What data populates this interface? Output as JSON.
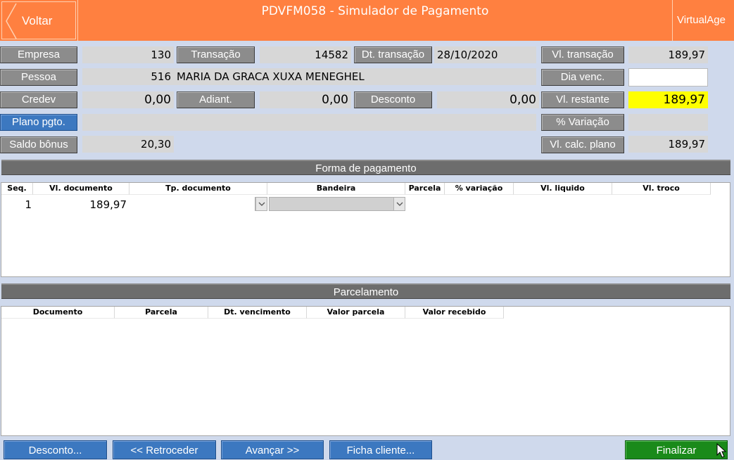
{
  "header": {
    "back_label": "Voltar",
    "title": "PDVFM058 - Simulador de Pagamento",
    "brand": "VirtualAge",
    "color": "#ff8040"
  },
  "form": {
    "empresa_label": "Empresa",
    "empresa_value": "130",
    "transacao_label": "Transação",
    "transacao_value": "14582",
    "dt_transacao_label": "Dt. transação",
    "dt_transacao_value": "28/10/2020",
    "vl_transacao_label": "Vl. transação",
    "vl_transacao_value": "189,97",
    "pessoa_label": "Pessoa",
    "pessoa_code": "516",
    "pessoa_name": "MARIA DA GRACA XUXA MENEGHEL",
    "dia_venc_label": "Dia venc.",
    "dia_venc_value": "",
    "credev_label": "Credev",
    "credev_value": "0,00",
    "adiant_label": "Adiant.",
    "adiant_value": "0,00",
    "desconto_label": "Desconto",
    "desconto_value": "0,00",
    "vl_restante_label": "Vl. restante",
    "vl_restante_value": "189,97",
    "plano_label": "Plano pgto.",
    "plano_value": "",
    "variacao_label": "% Variação",
    "variacao_value": "",
    "saldo_label": "Saldo bônus",
    "saldo_value": "20,30",
    "vl_calc_label": "Vl. calc. plano",
    "vl_calc_value": "189,97"
  },
  "forma_pagamento": {
    "title": "Forma de pagamento",
    "columns": [
      "Seq.",
      "Vl. documento",
      "Tp. documento",
      "Bandeira",
      "Parcela",
      "% variação",
      "Vl. liquido",
      "Vl. troco"
    ],
    "rows": [
      {
        "seq": "1",
        "vl_documento": "189,97",
        "tp_documento": "",
        "bandeira": "",
        "parcela": "",
        "variacao": "",
        "vl_liquido": "",
        "vl_troco": ""
      }
    ]
  },
  "parcelamento": {
    "title": "Parcelamento",
    "columns": [
      "Documento",
      "Parcela",
      "Dt. vencimento",
      "Valor parcela",
      "Valor recebido"
    ]
  },
  "footer": {
    "desconto": "Desconto...",
    "retroceder": "<< Retroceder",
    "avancar": "Avançar >>",
    "ficha": "Ficha cliente...",
    "finalizar": "Finalizar"
  }
}
